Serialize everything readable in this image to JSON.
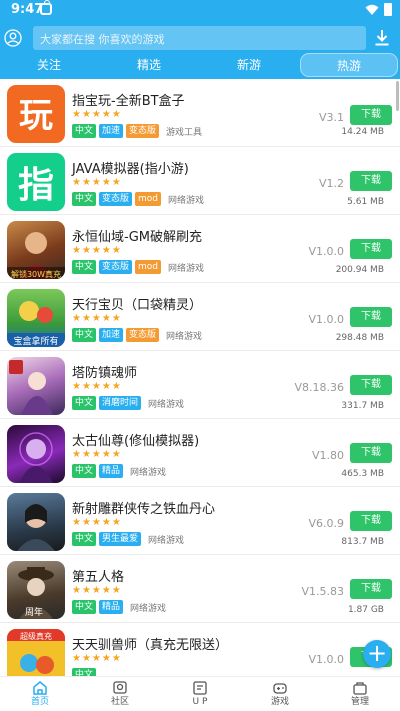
{
  "status_bar": {
    "time": "9:47"
  },
  "search": {
    "placeholder": "大家都在搜  你喜欢的游戏"
  },
  "tabs": [
    {
      "label": "关注",
      "active": false
    },
    {
      "label": "精选",
      "active": false
    },
    {
      "label": "新游",
      "active": false
    },
    {
      "label": "热游",
      "active": true
    }
  ],
  "colors": {
    "primary": "#29aef0",
    "download": "#2fc46a",
    "star": "#f5a623",
    "tag_green": "#29c36a",
    "tag_blue": "#29aef0",
    "tag_orange": "#f39a32"
  },
  "games": [
    {
      "title": "指宝玩-全新BT盒子",
      "stars": "★★★★★",
      "tags": [
        {
          "text": "中文",
          "color": "green"
        },
        {
          "text": "加速",
          "color": "blue"
        },
        {
          "text": "变态版",
          "color": "orange"
        }
      ],
      "category": "游戏工具",
      "version": "V3.1",
      "size": "14.24 MB",
      "button": "下载",
      "icon": "app-icon-zhibaowan"
    },
    {
      "title": "JAVA模拟器(指小游)",
      "stars": "★★★★★",
      "tags": [
        {
          "text": "中文",
          "color": "green"
        },
        {
          "text": "变态版",
          "color": "blue"
        },
        {
          "text": "mod",
          "color": "orange"
        }
      ],
      "category": "网络游戏",
      "version": "V1.2",
      "size": "5.61 MB",
      "button": "下载",
      "icon": "app-icon-java"
    },
    {
      "title": "永恒仙域-GM破解刷充",
      "stars": "★★★★★",
      "tags": [
        {
          "text": "中文",
          "color": "green"
        },
        {
          "text": "变态版",
          "color": "blue"
        },
        {
          "text": "mod",
          "color": "orange"
        }
      ],
      "category": "网络游戏",
      "version": "V1.0.0",
      "size": "200.94 MB",
      "button": "下载",
      "icon": "game-icon-yonghengxianyu"
    },
    {
      "title": "天行宝贝（口袋精灵）",
      "stars": "★★★★★",
      "tags": [
        {
          "text": "中文",
          "color": "green"
        },
        {
          "text": "加速",
          "color": "blue"
        },
        {
          "text": "变态版",
          "color": "orange"
        }
      ],
      "category": "网络游戏",
      "version": "V1.0.0",
      "size": "298.48 MB",
      "button": "下载",
      "icon": "game-icon-tianxingbaobei"
    },
    {
      "title": "塔防镇魂师",
      "stars": "★★★★★",
      "tags": [
        {
          "text": "中文",
          "color": "green"
        },
        {
          "text": "消磨时间",
          "color": "blue"
        }
      ],
      "category": "网络游戏",
      "version": "V8.18.36",
      "size": "331.7 MB",
      "button": "下载",
      "icon": "game-icon-tafangzhenhunshi"
    },
    {
      "title": "太古仙尊(修仙模拟器)",
      "stars": "★★★★★",
      "tags": [
        {
          "text": "中文",
          "color": "green"
        },
        {
          "text": "精品",
          "color": "blue"
        }
      ],
      "category": "网络游戏",
      "version": "V1.80",
      "size": "465.3 MB",
      "button": "下载",
      "icon": "game-icon-taiguxianzun"
    },
    {
      "title": "新射雕群侠传之铁血丹心",
      "stars": "★★★★★",
      "tags": [
        {
          "text": "中文",
          "color": "green"
        },
        {
          "text": "男生最爱",
          "color": "blue"
        }
      ],
      "category": "网络游戏",
      "version": "V6.0.9",
      "size": "813.7 MB",
      "button": "下载",
      "icon": "game-icon-shediao"
    },
    {
      "title": "第五人格",
      "stars": "★★★★★",
      "tags": [
        {
          "text": "中文",
          "color": "green"
        },
        {
          "text": "精品",
          "color": "blue"
        }
      ],
      "category": "网络游戏",
      "version": "V1.5.83",
      "size": "1.87 GB",
      "button": "下载",
      "icon": "game-icon-diwurenge"
    },
    {
      "title": "天天驯兽师（真充无限送）",
      "stars": "★★★★★",
      "tags": [
        {
          "text": "中文",
          "color": "green"
        }
      ],
      "category": "",
      "version": "V1.0.0",
      "size": "",
      "button": "下载",
      "icon": "game-icon-tiantianxunshoushi"
    }
  ],
  "bottom_nav": [
    {
      "label": "首页",
      "icon": "home-icon",
      "active": true
    },
    {
      "label": "社区",
      "icon": "community-icon",
      "active": false
    },
    {
      "label": "U P",
      "icon": "up-icon",
      "active": false
    },
    {
      "label": "游戏",
      "icon": "gamepad-icon",
      "active": false
    },
    {
      "label": "管理",
      "icon": "manage-icon",
      "active": false
    }
  ],
  "fab": {
    "label": "+"
  }
}
